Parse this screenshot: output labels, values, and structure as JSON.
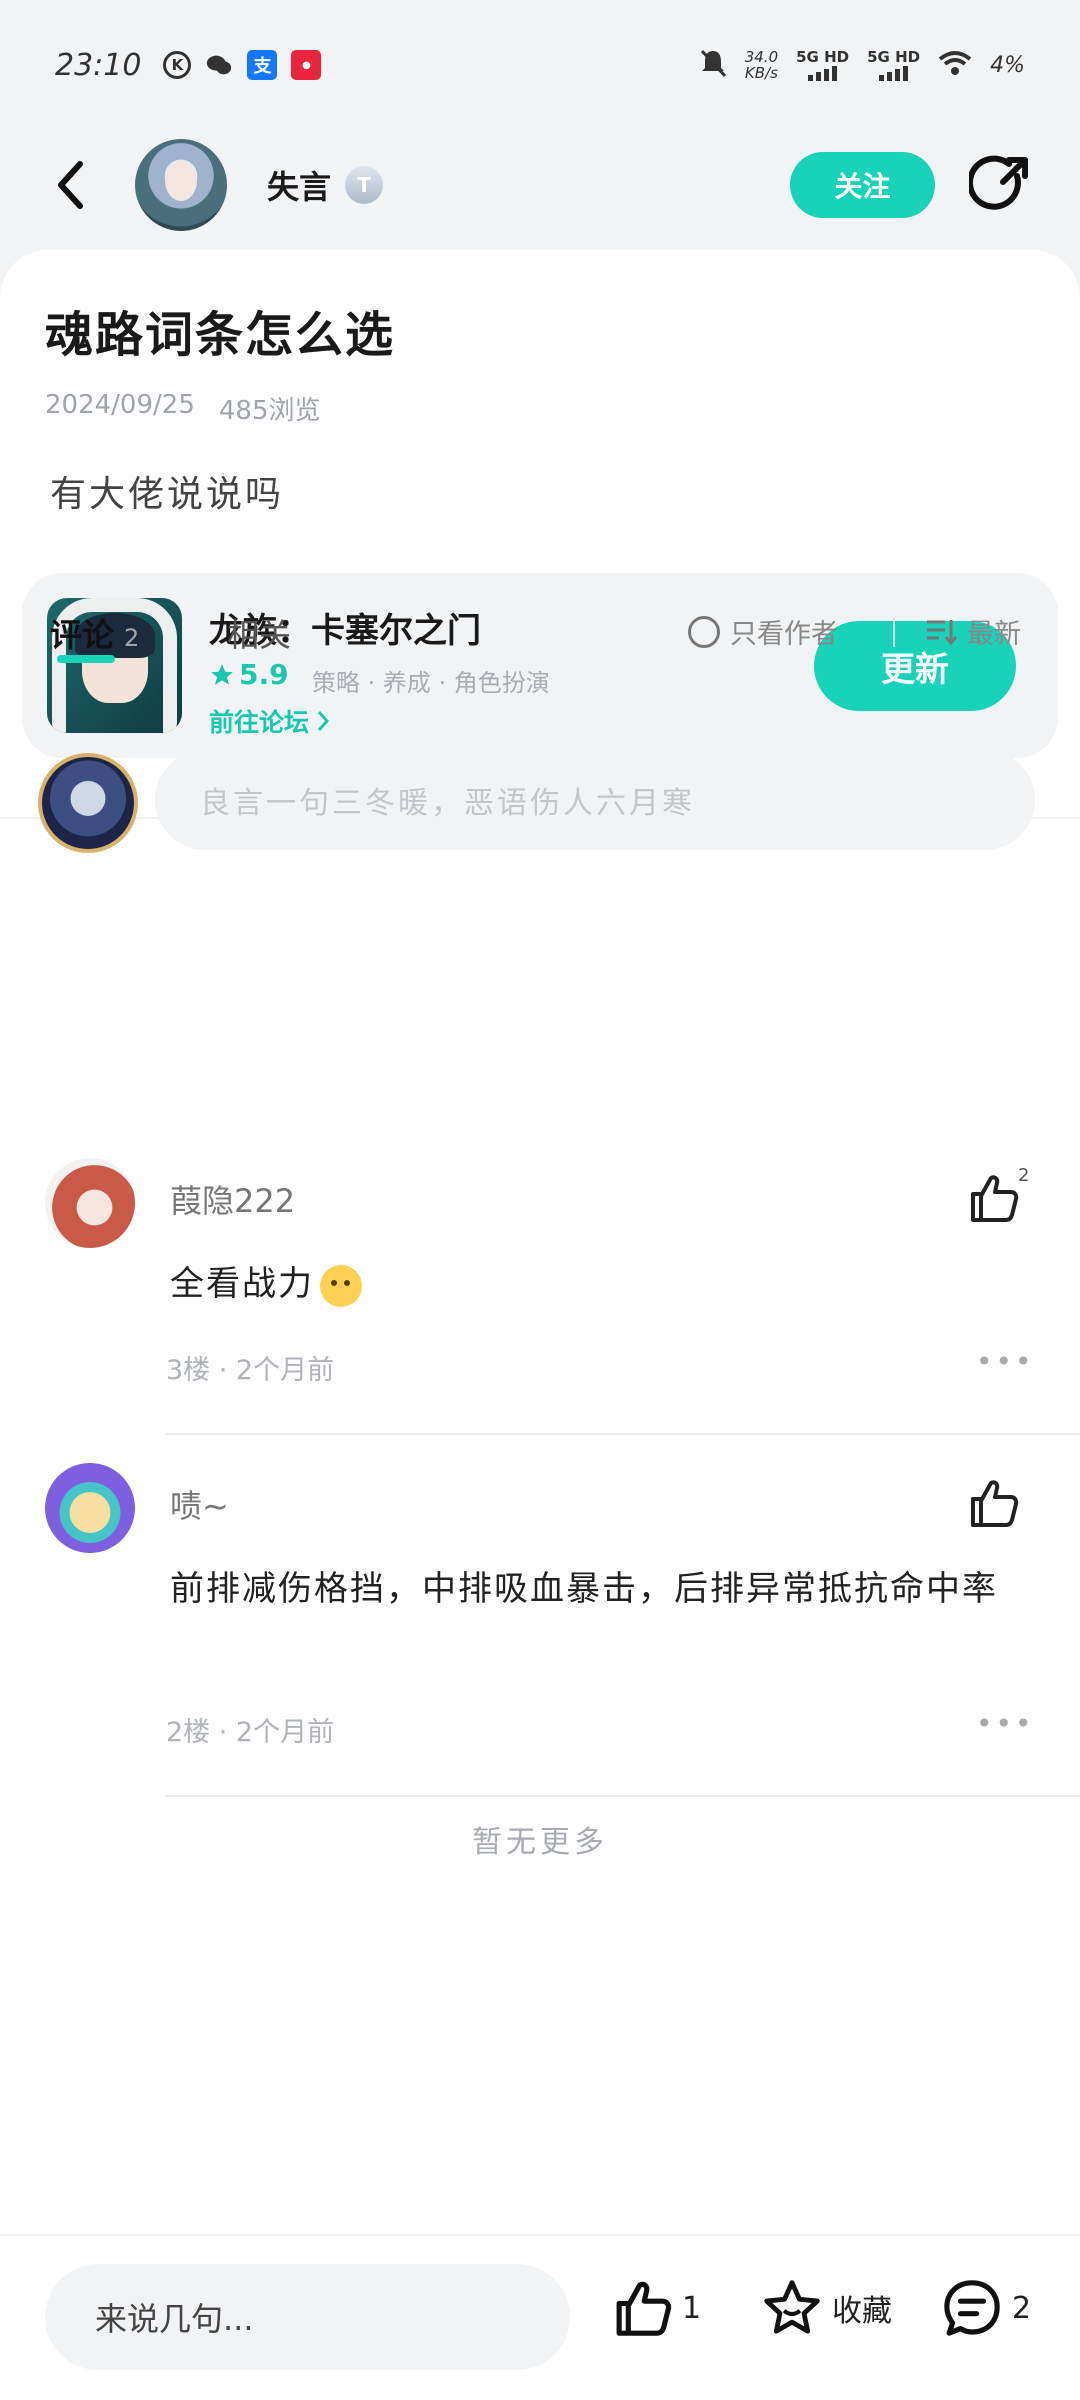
{
  "status_bar": {
    "time": "23:10",
    "speed_value": "34.0",
    "speed_unit": "KB/s",
    "network1": "5G HD",
    "network2": "5G HD",
    "battery": "4%"
  },
  "header": {
    "author_name": "失言",
    "level_badge": "T",
    "follow_label": "关注"
  },
  "post": {
    "title": "魂路词条怎么选",
    "date": "2024/09/25",
    "views": "485浏览",
    "body": "有大佬说说吗"
  },
  "game": {
    "name": "龙族：卡塞尔之门",
    "rating": "5.9",
    "tags": "策略 · 养成 · 角色扮演",
    "forum_link": "前往论坛",
    "update_label": "更新"
  },
  "tabs": {
    "comments_label": "评论",
    "comments_count": "2",
    "related_label": "相关",
    "author_only": "只看作者",
    "sort_label": "最新"
  },
  "comment_input": {
    "placeholder": "良言一句三冬暖，恶语伤人六月寒"
  },
  "comments": [
    {
      "name": "葭隐222",
      "text": "全看战力",
      "likes": "2",
      "meta": "3楼 · 2个月前"
    },
    {
      "name": "啧~",
      "text": "前排减伤格挡，中排吸血暴击，后排异常抵抗命中率",
      "likes": "",
      "meta": "2楼 · 2个月前"
    }
  ],
  "no_more": "暂无更多",
  "bottom_bar": {
    "reply_placeholder": "来说几句...",
    "like_count": "1",
    "favorite_label": "收藏",
    "comment_count": "2"
  },
  "colors": {
    "accent": "#18d2b9",
    "background": "#f2f3f5"
  }
}
